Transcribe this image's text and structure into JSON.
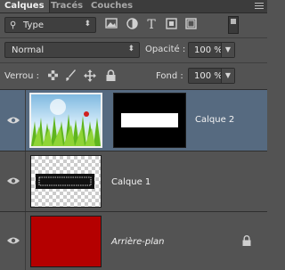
{
  "tabs": [
    {
      "label": "Calques",
      "active": true
    },
    {
      "label": "Tracés",
      "active": false
    },
    {
      "label": "Couches",
      "active": false
    }
  ],
  "filter": {
    "type_label": "Type",
    "icons": [
      "image-filter-icon",
      "adjustment-filter-icon",
      "type-filter-icon",
      "shape-filter-icon",
      "smart-object-filter-icon"
    ]
  },
  "blend_mode": "Normal",
  "opacity": {
    "label": "Opacité :",
    "value": "100 %"
  },
  "lock": {
    "label": "Verrou :"
  },
  "fill": {
    "label": "Fond :",
    "value": "100 %"
  },
  "layers": [
    {
      "name": "Calque 2",
      "selected": true
    },
    {
      "name": "Calque 1",
      "selected": false
    },
    {
      "name": "Arrière-plan",
      "selected": false,
      "italic": true,
      "locked": true
    }
  ],
  "colors": {
    "panel": "#535353",
    "selected": "#566a80",
    "background_fill": "#b40000"
  }
}
